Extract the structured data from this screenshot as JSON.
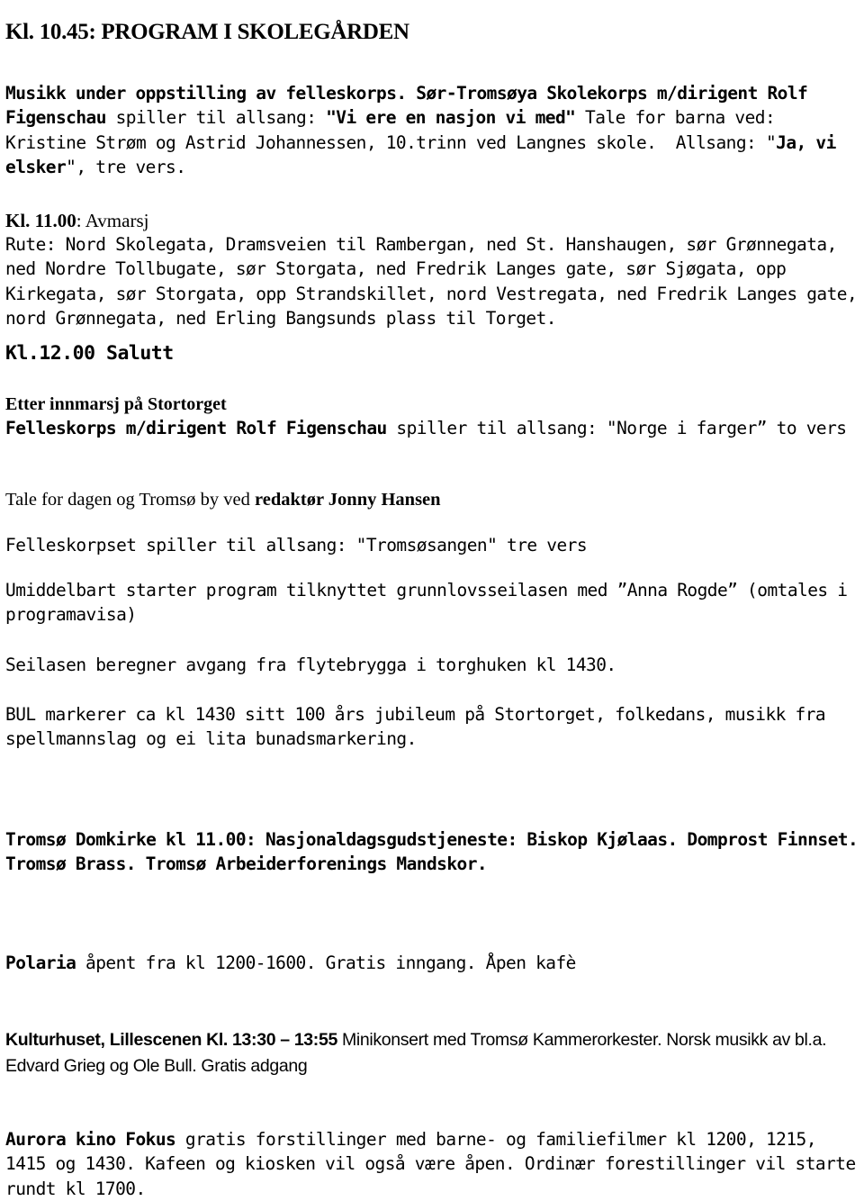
{
  "document": {
    "title": "Kl. 10.45: PROGRAM I SKOLEGÅRDEN",
    "background_color": "#ffffff",
    "text_color": "#000000"
  },
  "sections": {
    "musikk": {
      "bold_1": "Musikk under oppstilling av felleskorps.",
      "bold_2": " Sør-Tromsøya Skolekorps m/dirigent Rolf Figenschau",
      "regular_1": " spiller til allsang: ",
      "bold_3": "\"Vi ere en nasjon vi med\"",
      "regular_2": " Tale for barna ved: Kristine Strøm og Astrid Johannessen, 10.trinn ved Langnes skole.  Allsang: \"",
      "bold_4": "Ja, vi elsker",
      "regular_3": "\", tre vers."
    },
    "avmarsj": {
      "label": "Kl. 11.00",
      "value": ": Avmarsj",
      "route": "Rute: Nord Skolegata, Dramsveien til Rambergan, ned St. Hanshaugen, sør Grønnegata, ned Nordre Tollbugate, sør Storgata, ned Fredrik Langes gate, sør Sjøgata, opp Kirkegata, sør Storgata, opp Strandskillet, nord Vestregata, ned Fredrik Langes gate, nord Grønnegata, ned Erling Bangsunds plass til Torget."
    },
    "salutt": {
      "heading": "Kl.12.00 Salutt",
      "innmarsj_heading": "Etter innmarsj på Stortorget",
      "felleskorps_bold": "Felleskorps m/dirigent Rolf Figenschau",
      "felleskorps_regular": " spiller til allsang: \"Norge i farger” to vers",
      "tale_regular": "Tale for dagen og Tromsø by ved ",
      "tale_bold": "redaktør Jonny Hansen",
      "tromsosangen": "Felleskorpset spiller til allsang: \"Tromsøsangen\" tre vers",
      "umiddelbart": "Umiddelbart starter program tilknyttet grunnlovsseilasen med ”Anna Rogde” (omtales i programavisa)",
      "seilasen": "Seilasen beregner avgang fra flytebrygga i torghuken kl 1430.",
      "bul": "BUL markerer ca kl 1430 sitt 100 års jubileum på Stortorget, folkedans, musikk fra spellmannslag og ei lita bunadsmarkering."
    },
    "divider": {
      "asterisks": "*******"
    },
    "domkirke": {
      "text": "Tromsø Domkirke kl 11.00: Nasjonaldagsgudstjeneste: Biskop Kjølaas. Domprost Finnset. Tromsø Brass. Tromsø Arbeiderforenings Mandskor."
    },
    "polaria": {
      "bold": "Polaria",
      "regular": " åpent fra kl 1200-1600. Gratis inngang. Åpen kafè"
    },
    "kulturhuset": {
      "bold": "Kulturhuset, Lillescenen Kl. 13:30 – 13:55",
      "regular": " Minikonsert med Tromsø Kammerorkester. Norsk musikk av bl.a. Edvard Grieg og Ole Bull. Gratis adgang"
    },
    "aurora": {
      "bold": "Aurora kino Fokus",
      "regular": " gratis forstillinger med barne- og familiefilmer kl 1200, 1215, 1415 og 1430. Kafeen og kiosken vil også være åpen. Ordinær forestillinger vil starte rundt kl 1700."
    }
  }
}
